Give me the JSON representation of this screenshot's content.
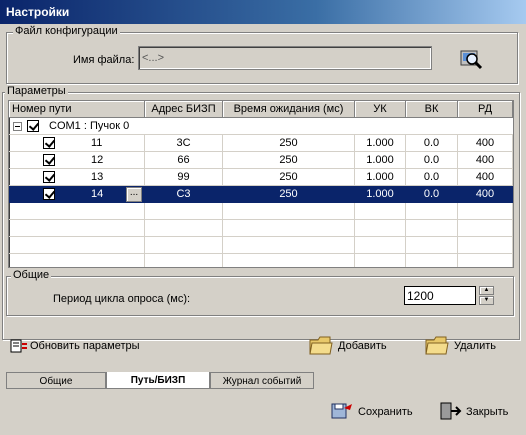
{
  "window": {
    "title": "Настройки"
  },
  "config_file": {
    "legend": "Файл конфигурации",
    "label": "Имя файла:",
    "value": "<...>",
    "browse_icon": "folder-search-icon"
  },
  "params": {
    "legend": "Параметры",
    "columns": [
      "Номер пути",
      "Адрес БИЗП",
      "Время ожидания (мс)",
      "УК",
      "ВК",
      "РД"
    ],
    "group_row": {
      "label": "COM1 : Пучок 0",
      "checked": true
    },
    "rows": [
      {
        "checked": true,
        "path": "11",
        "address": "3C",
        "timeout": "250",
        "uk": "1.000",
        "vk": "0.0",
        "rd": "400",
        "selected": false
      },
      {
        "checked": true,
        "path": "12",
        "address": "66",
        "timeout": "250",
        "uk": "1.000",
        "vk": "0.0",
        "rd": "400",
        "selected": false
      },
      {
        "checked": true,
        "path": "13",
        "address": "99",
        "timeout": "250",
        "uk": "1.000",
        "vk": "0.0",
        "rd": "400",
        "selected": false
      },
      {
        "checked": true,
        "path": "14",
        "address": "C3",
        "timeout": "250",
        "uk": "1.000",
        "vk": "0.0",
        "rd": "400",
        "selected": true
      }
    ],
    "ellipsis": "..."
  },
  "common": {
    "legend": "Общие",
    "poll_label": "Период цикла опроса (мс):",
    "poll_value": "1200"
  },
  "actions": {
    "refresh": "Обновить параметры",
    "add": "Добавить",
    "delete": "Удалить"
  },
  "tabs": [
    "Общие",
    "Путь/БИЗП",
    "Журнал событий"
  ],
  "active_tab": "Путь/БИЗП",
  "footer": {
    "save": "Сохранить",
    "close": "Закрыть"
  },
  "colors": {
    "title_start": "#0a246a",
    "title_end": "#a6caf0",
    "selection": "#0a246a",
    "face": "#d4d0c8"
  }
}
